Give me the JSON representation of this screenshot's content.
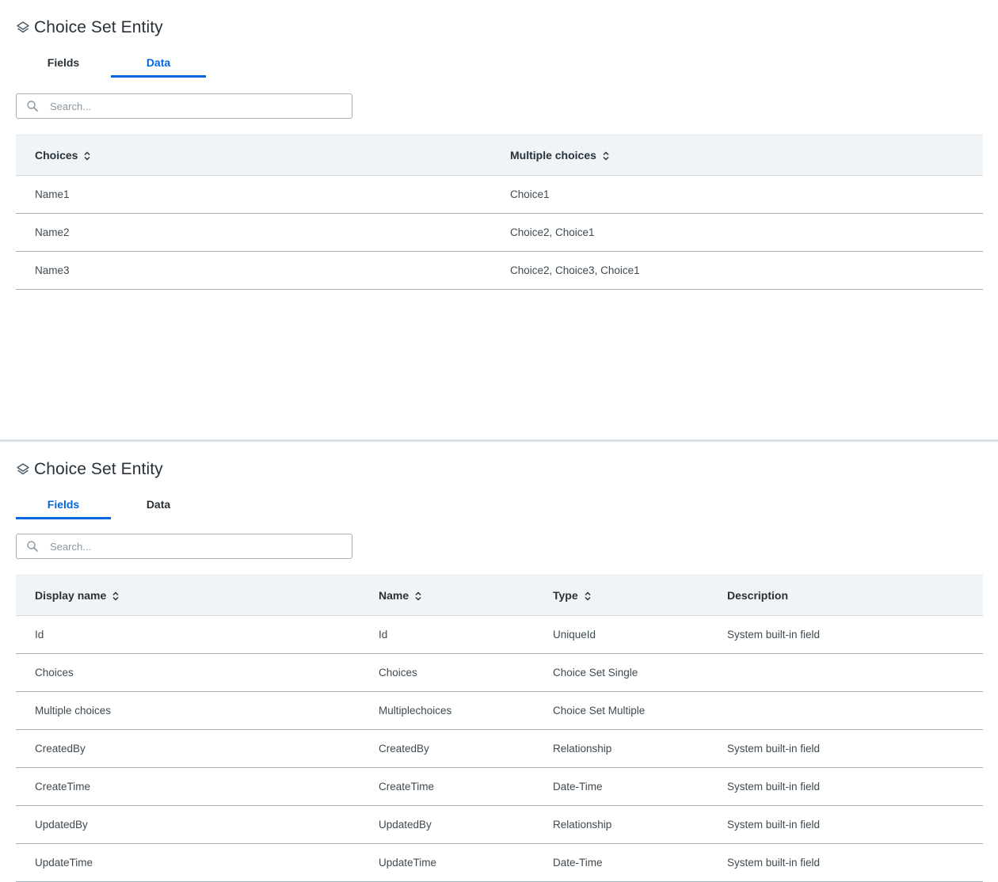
{
  "top_panel": {
    "title": "Choice Set Entity",
    "tabs": [
      {
        "label": "Fields",
        "active": false
      },
      {
        "label": "Data",
        "active": true
      }
    ],
    "search": {
      "placeholder": "Search...",
      "value": ""
    },
    "columns": [
      "Choices",
      "Multiple choices"
    ],
    "rows": [
      [
        "Name1",
        "Choice1"
      ],
      [
        "Name2",
        "Choice2, Choice1"
      ],
      [
        "Name3",
        "Choice2, Choice3, Choice1"
      ]
    ]
  },
  "bottom_panel": {
    "title": "Choice Set Entity",
    "tabs": [
      {
        "label": "Fields",
        "active": true
      },
      {
        "label": "Data",
        "active": false
      }
    ],
    "search": {
      "placeholder": "Search...",
      "value": ""
    },
    "columns": [
      "Display name",
      "Name",
      "Type",
      "Description"
    ],
    "rows": [
      [
        "Id",
        "Id",
        "UniqueId",
        "System built-in field"
      ],
      [
        "Choices",
        "Choices",
        "Choice Set Single",
        ""
      ],
      [
        "Multiple choices",
        "Multiplechoices",
        "Choice Set Multiple",
        ""
      ],
      [
        "CreatedBy",
        "CreatedBy",
        "Relationship",
        "System built-in field"
      ],
      [
        "CreateTime",
        "CreateTime",
        "Date-Time",
        "System built-in field"
      ],
      [
        "UpdatedBy",
        "UpdatedBy",
        "Relationship",
        "System built-in field"
      ],
      [
        "UpdateTime",
        "UpdateTime",
        "Date-Time",
        "System built-in field"
      ]
    ]
  },
  "colors": {
    "accent": "#0067df",
    "header_bg": "#f0f4f7",
    "text": "#273139",
    "border": "#a4b1b8"
  },
  "icons": {
    "title": "entity-layers-icon",
    "search": "search-icon",
    "sort": "sort-arrows-icon"
  }
}
